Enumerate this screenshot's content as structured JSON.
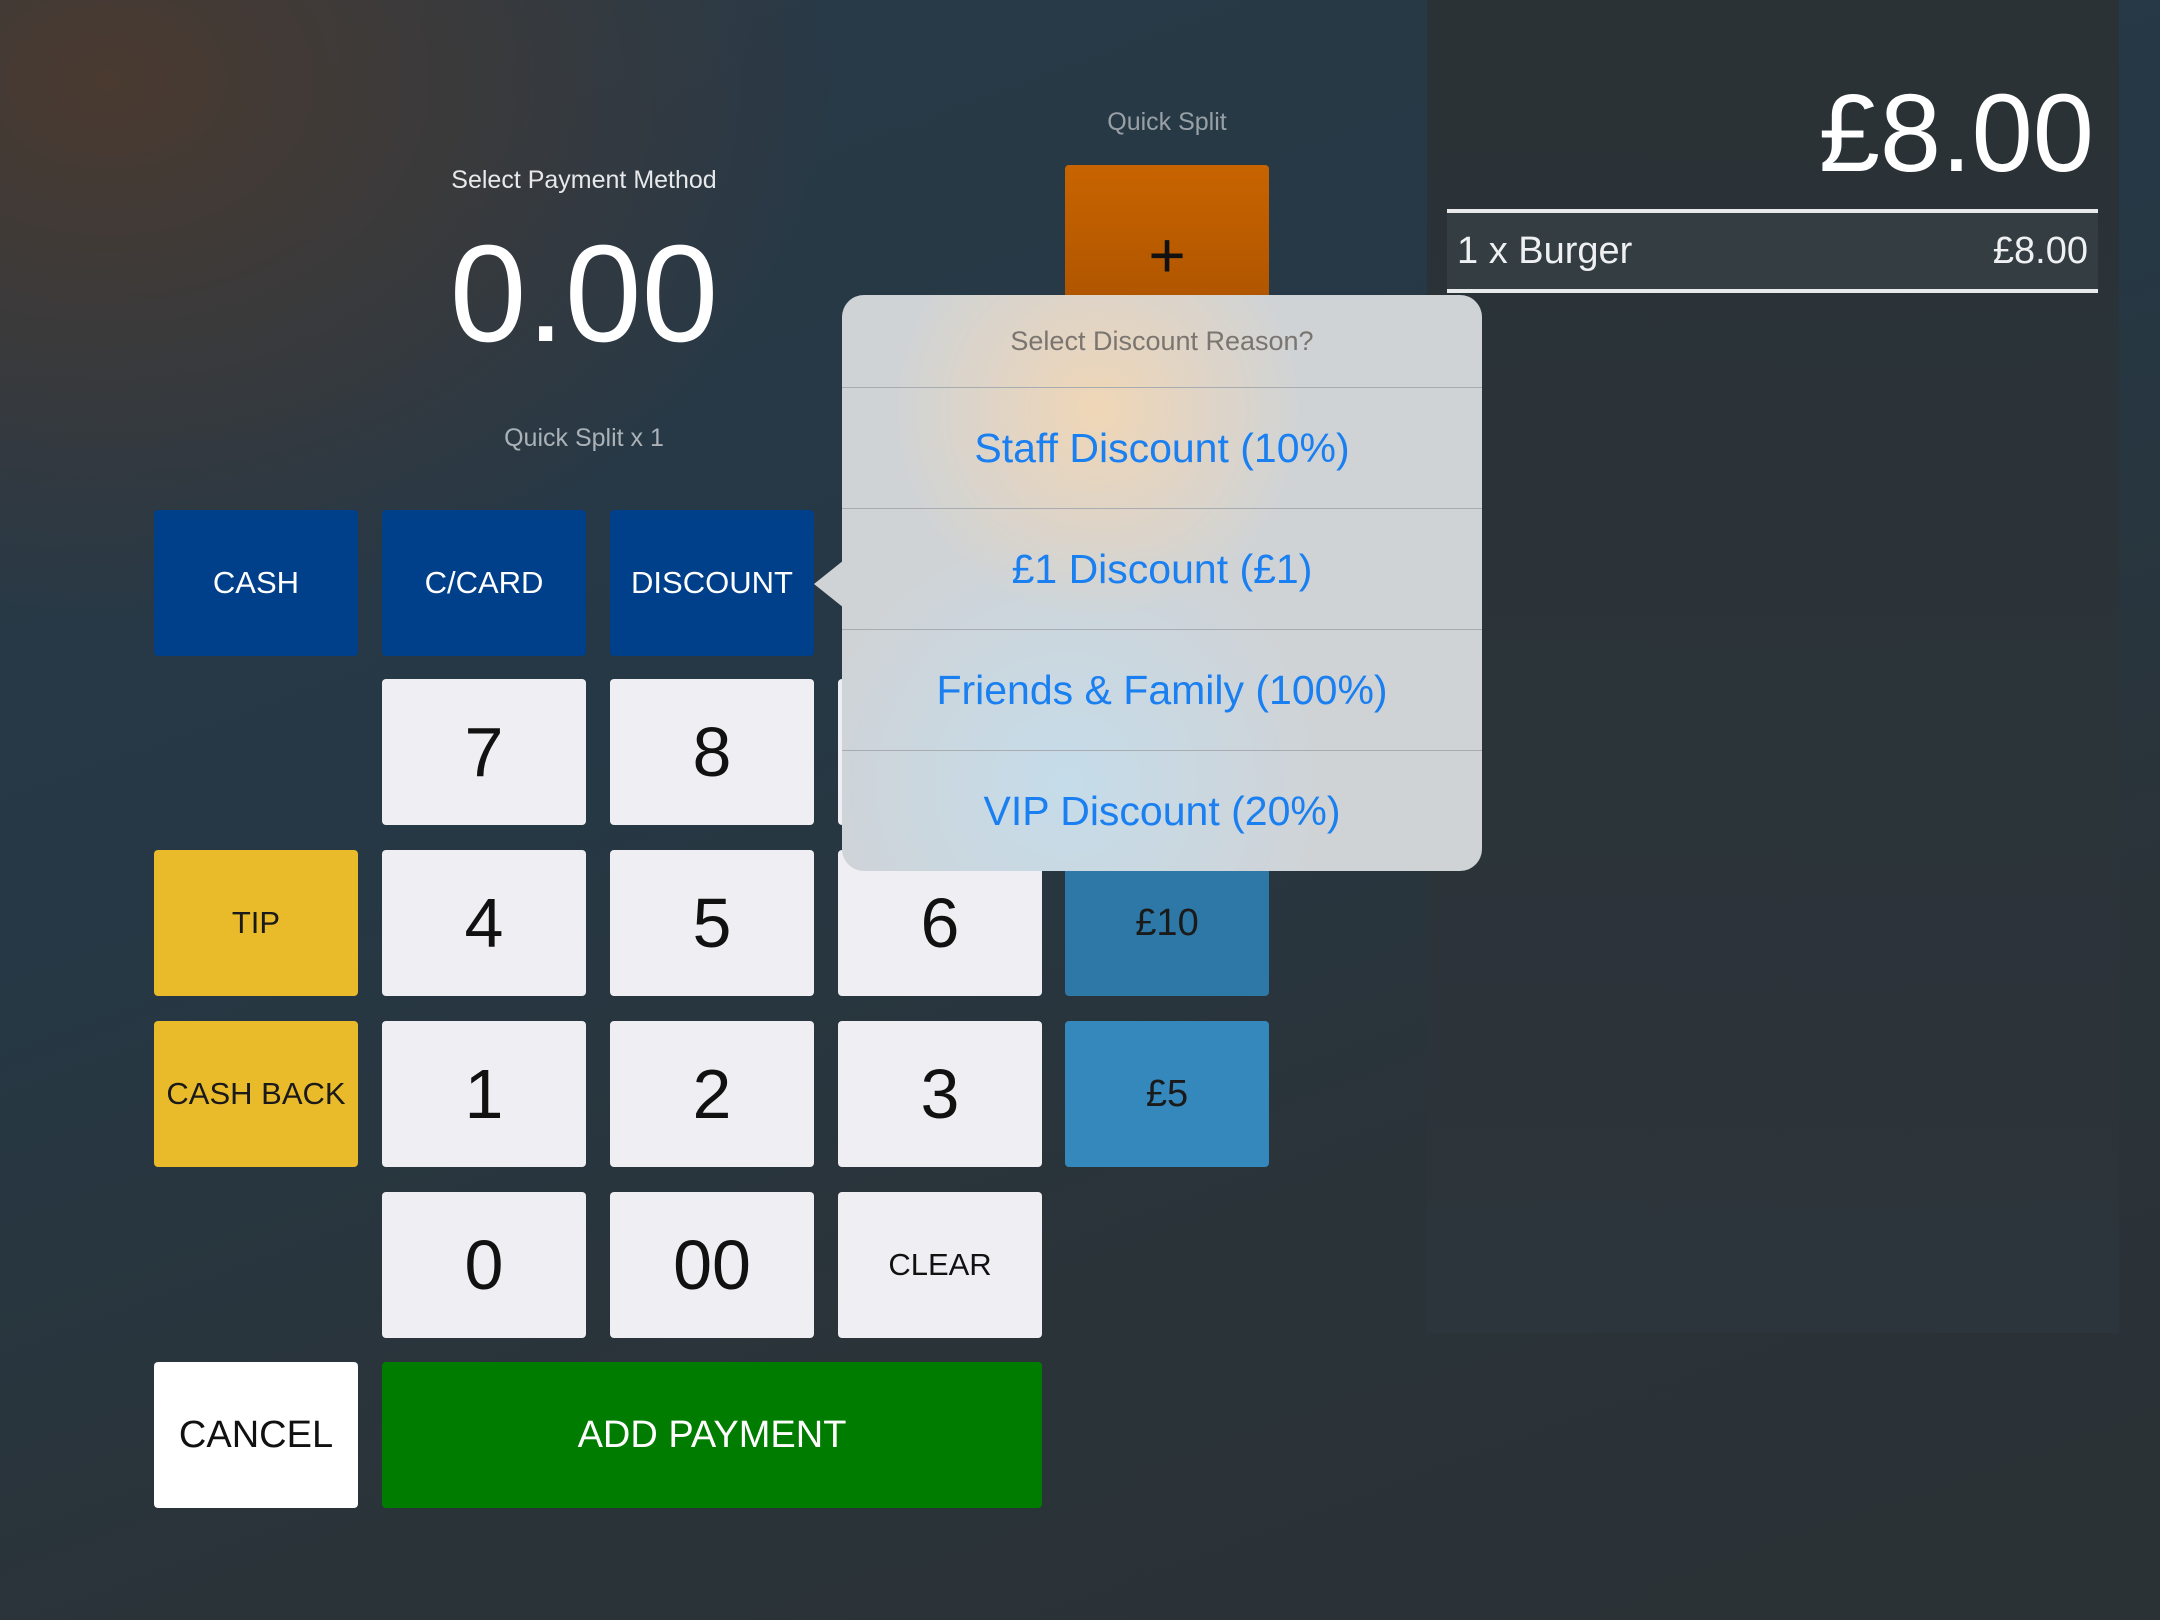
{
  "header": {
    "title": "Select Payment Method",
    "amount": "0.00",
    "quick_split_count": "Quick Split x 1",
    "quick_split_label": "Quick Split",
    "quick_split_add": "+"
  },
  "methods": [
    "CASH",
    "C/CARD",
    "DISCOUNT"
  ],
  "keypad": {
    "k7": "7",
    "k8": "8",
    "k4": "4",
    "k5": "5",
    "k6": "6",
    "k1": "1",
    "k2": "2",
    "k3": "3",
    "k0": "0",
    "k00": "00",
    "clear": "CLEAR"
  },
  "side": {
    "tip": "TIP",
    "cash_back": "CASH BACK"
  },
  "quick_amounts": [
    "£10",
    "£5"
  ],
  "actions": {
    "cancel": "CANCEL",
    "add_payment": "ADD PAYMENT"
  },
  "order": {
    "total": "£8.00",
    "items": [
      {
        "desc": "1 x Burger",
        "price": "£8.00"
      }
    ]
  },
  "popover": {
    "title": "Select Discount Reason?",
    "options": [
      "Staff Discount (10%)",
      "£1 Discount (£1)",
      "Friends & Family (100%)",
      "VIP Discount (20%)"
    ]
  },
  "colors": {
    "payment_method": "#003f8a",
    "keypad": "#efeff3",
    "side": "#e9bb2a",
    "quick": "#3588bc",
    "add": "#007d00",
    "split": "#c86400",
    "link": "#1a7ff0"
  }
}
